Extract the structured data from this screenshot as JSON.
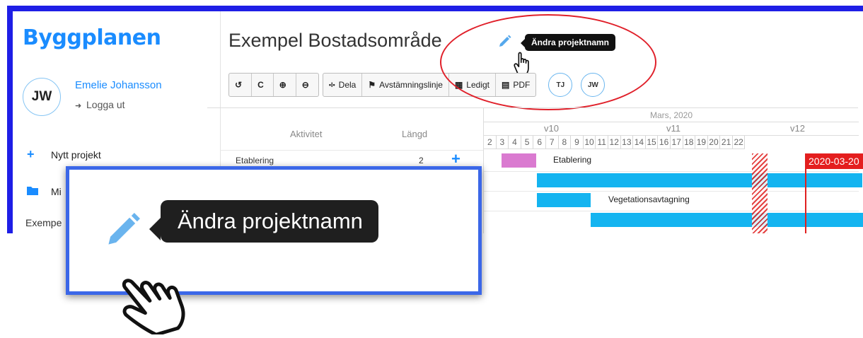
{
  "app": {
    "logo": "Byggplanen",
    "user": {
      "initials": "JW",
      "name": "Emelie Johansson",
      "logout_label": "Logga ut"
    },
    "sidebar": {
      "items": [
        {
          "label": "Nytt projekt",
          "icon": "plus-icon"
        },
        {
          "label": "Mi",
          "icon": "folder-icon"
        }
      ],
      "project_link": "Exempe"
    }
  },
  "project": {
    "title": "Exempel Bostadsområde",
    "edit_tooltip": "Ändra projektnamn"
  },
  "toolbar": {
    "buttons": [
      {
        "label": "",
        "icon": "undo-icon",
        "glyph": "↺"
      },
      {
        "label": "",
        "icon": "redo-icon",
        "glyph": "C"
      },
      {
        "label": "",
        "icon": "zoom-in-icon",
        "glyph": "⊕"
      },
      {
        "label": "",
        "icon": "zoom-out-icon",
        "glyph": "⊖"
      },
      {
        "label": "Dela",
        "icon": "split-icon",
        "glyph": "•I•"
      },
      {
        "label": "Avstämningslinje",
        "icon": "flag-icon",
        "glyph": "⚑"
      },
      {
        "label": "Ledigt",
        "icon": "calendar-icon",
        "glyph": "▦"
      },
      {
        "label": "PDF",
        "icon": "file-icon",
        "glyph": "▤"
      }
    ],
    "members": [
      "TJ",
      "JW"
    ]
  },
  "gantt": {
    "columns": {
      "activity": "Aktivitet",
      "length": "Längd"
    },
    "month": "Mars, 2020",
    "weeks": [
      "v10",
      "v11",
      "v12"
    ],
    "days": [
      "2",
      "3",
      "4",
      "5",
      "6",
      "7",
      "8",
      "9",
      "10",
      "11",
      "12",
      "13",
      "14",
      "15",
      "16",
      "17",
      "18",
      "19",
      "20",
      "21",
      "22"
    ],
    "tasks": [
      {
        "name": "Etablering",
        "length": "2",
        "bar_label": "Etablering",
        "color": "#da7ad0"
      },
      {
        "name": "",
        "length": "",
        "bar_label": "",
        "color": "#14b4f0"
      },
      {
        "name": "",
        "length": "",
        "bar_label": "Vegetationsavtagning",
        "color": "#14b4f0"
      },
      {
        "name": "",
        "length": "",
        "bar_label": "",
        "color": "#14b4f0"
      }
    ],
    "today_label": "2020-03-20",
    "colors": {
      "accent": "#1a8cff",
      "today": "#e41e1e",
      "bar": "#14b4f0"
    }
  },
  "callout": {
    "tooltip": "Ändra projektnamn"
  }
}
